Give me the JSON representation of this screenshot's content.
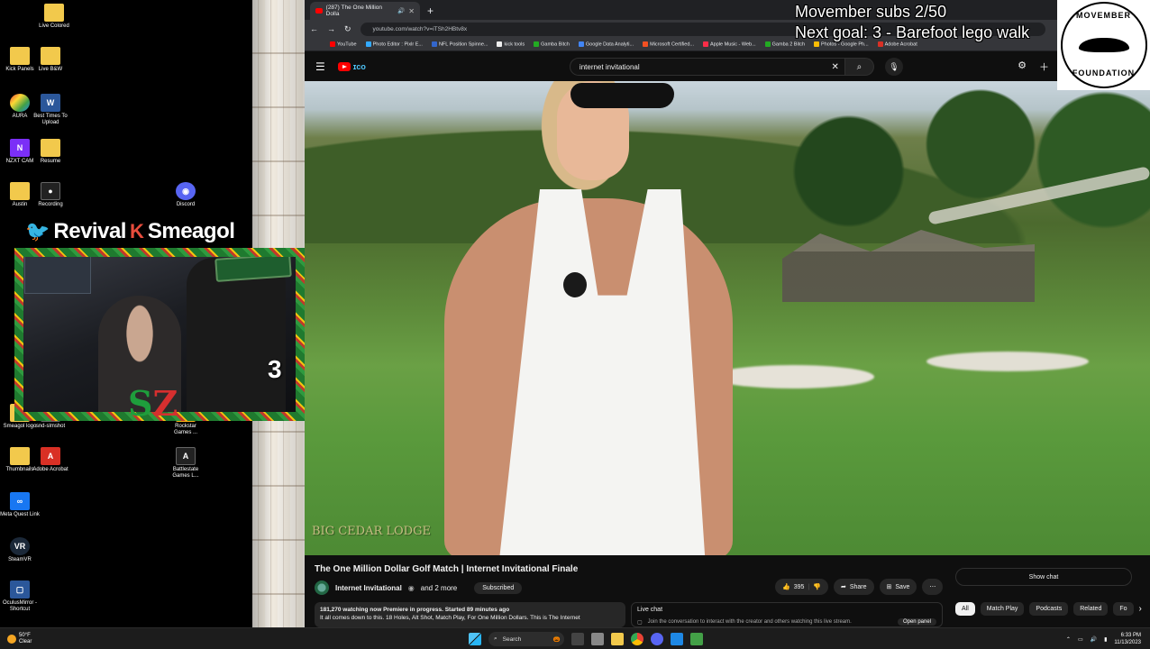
{
  "desktop": {
    "icons": [
      {
        "label": "",
        "kind": "doc"
      },
      {
        "label": "Live Colored",
        "kind": "folder"
      },
      {
        "label": "Kick Panels",
        "kind": "folder"
      },
      {
        "label": "Live B&W",
        "kind": "folder"
      },
      {
        "label": "AURA",
        "kind": "aura"
      },
      {
        "label": "Best Times To Upload",
        "kind": "doc"
      },
      {
        "label": "NZXT CAM",
        "kind": "nzxt"
      },
      {
        "label": "Resume",
        "kind": "folder"
      },
      {
        "label": "Austin",
        "kind": "folder"
      },
      {
        "label": "Recording",
        "kind": "dark"
      },
      {
        "label": "Discord",
        "kind": "disc"
      },
      {
        "label": "Smeagol logo",
        "kind": "folder"
      },
      {
        "label": "snd-slmshot",
        "kind": "dark"
      },
      {
        "label": "Rockstar Games ...",
        "kind": "rock"
      },
      {
        "label": "Thumbnails",
        "kind": "folder"
      },
      {
        "label": "Adobe Acrobat",
        "kind": "pdf"
      },
      {
        "label": "Battlestate Games L...",
        "kind": "dark"
      },
      {
        "label": "Meta Quest Link",
        "kind": "meta"
      },
      {
        "label": "SteamVR",
        "kind": "vr"
      },
      {
        "label": "OculusMirror - Shortcut",
        "kind": "doc"
      }
    ]
  },
  "stream": {
    "banner_name": "Revival",
    "banner_name2": "Smeagol",
    "webcam_number": "3",
    "logo_s": "S",
    "logo_z": "Z"
  },
  "browser": {
    "tab_title": "(287) The One Million Dolla",
    "url": "youtube.com/watch?v=iTSh2HBtv8x",
    "bookmarks": [
      "YouTube",
      "Photo Editor : Pixlr E...",
      "NFL Position Spinne...",
      "kick tools",
      "Gamba Bitch",
      "Google Data Analyti...",
      "Microsoft Certified...",
      "Apple Music - Web...",
      "Gamba 2 Bitch",
      "Photos - Google Ph...",
      "Adobe Acrobat"
    ]
  },
  "youtube": {
    "search_value": "internet invitational",
    "video_watermark": "BIG CEDAR LODGE",
    "title": "The One Million Dollar Golf Match | Internet Invitational Finale",
    "channel": "Internet Invitational",
    "channel_suffix": "and 2 more",
    "subscribe_label": "Subscribed",
    "likes": "395",
    "share_label": "Share",
    "save_label": "Save",
    "description_stats": "181,270 watching now  Premiere in progress. Started 89 minutes ago",
    "description_text": "It all comes down to this. 18 Holes, Alt Shot, Match Play, For One Million Dollars. This is The Internet",
    "live_chat_label": "Live chat",
    "live_chat_hint": "Join the conversation to interact with the creator and others watching this live stream.",
    "open_panel_label": "Open panel",
    "show_chat_label": "Show chat",
    "chips": [
      "All",
      "Match Play",
      "Podcasts",
      "Related",
      "Fo"
    ]
  },
  "overlay": {
    "movember_line1": "Movember subs 2/50",
    "movember_line2": "Next goal: 3 - Barefoot lego walk",
    "logo_top": "MOVEMBER",
    "logo_bottom": "FOUNDATION"
  },
  "taskbar": {
    "weather_temp": "50°F",
    "weather_cond": "Clear",
    "search_label": "Search",
    "time": "6:33 PM",
    "date": "11/13/2023"
  }
}
